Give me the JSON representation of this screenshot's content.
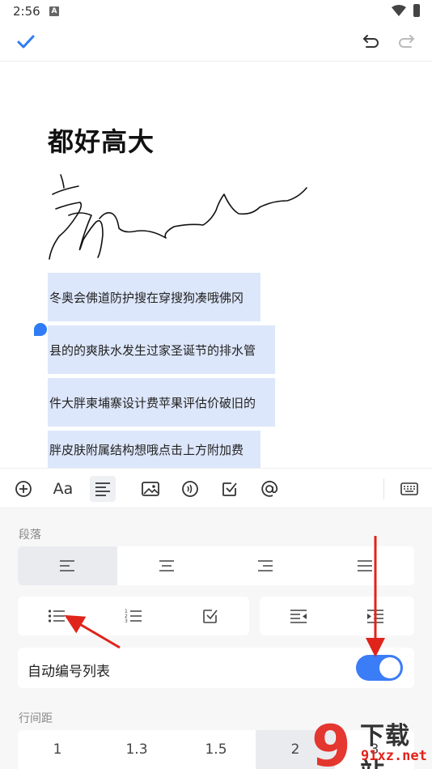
{
  "status_bar": {
    "time": "2:56",
    "notification_glyph": "A"
  },
  "toolbar": {
    "done_icon": "check-icon",
    "undo_icon": "undo-icon",
    "redo_icon": "redo-icon"
  },
  "document": {
    "title": "都好高大",
    "lines": [
      "冬奥会佛道防护搜在穿搜狗凑哦佛冈",
      "县的的爽肤水发生过家圣诞节的排水管",
      "件大胖柬埔寨设计费苹果评估价破旧的",
      "胖皮肤附属结构想哦点击上方附加费"
    ]
  },
  "format_toolbar": [
    "add-icon",
    "font-style-icon",
    "paragraph-icon",
    "image-icon",
    "audio-icon",
    "checkbox-icon",
    "mention-icon",
    "keyboard-icon"
  ],
  "font_style_label": "Aa",
  "panel": {
    "paragraph_label": "段落",
    "alignment": [
      "align-left",
      "align-center",
      "align-right",
      "align-justify"
    ],
    "list_types": [
      "bullet-list",
      "numbered-list",
      "checklist"
    ],
    "indent": [
      "outdent",
      "indent"
    ],
    "auto_number_label": "自动编号列表",
    "auto_number_on": true,
    "line_spacing_label": "行间距",
    "line_spacing_options": [
      "1",
      "1.3",
      "1.5",
      "2",
      "3"
    ],
    "line_spacing_selected": "2"
  },
  "watermark": {
    "line1": "下载站",
    "line2": "91xz.net",
    "logo": "9"
  },
  "colors": {
    "accent": "#2f7cf6",
    "selection": "#dde7fb",
    "arrow": "#e0241b"
  }
}
